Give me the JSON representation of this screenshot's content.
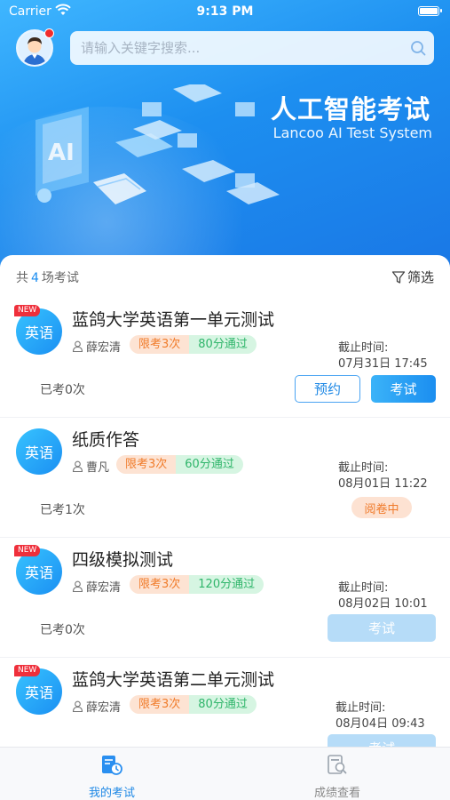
{
  "status_bar": {
    "carrier": "Carrier",
    "time": "9:13 PM"
  },
  "search": {
    "placeholder": "请输入关键字搜索..."
  },
  "hero": {
    "title": "人工智能考试",
    "subtitle": "Lancoo AI Test System"
  },
  "summary": {
    "prefix": "共",
    "count": "4",
    "suffix": "场考试",
    "filter_label": "筛选"
  },
  "exams": [
    {
      "new": "NEW",
      "subject": "英语",
      "title": "蓝鸽大学英语第一单元测试",
      "teacher": "薛宏清",
      "limit": "限考3次",
      "pass": "80分通过",
      "deadline_label": "截止时间:",
      "deadline": "07月31日 17:45",
      "taken": "已考0次",
      "btn_reserve": "预约",
      "btn_exam": "考试"
    },
    {
      "subject": "英语",
      "title": "纸质作答",
      "teacher": "曹凡",
      "limit": "限考3次",
      "pass": "60分通过",
      "deadline_label": "截止时间:",
      "deadline": "08月01日 11:22",
      "taken": "已考1次",
      "status": "阅卷中"
    },
    {
      "new": "NEW",
      "subject": "英语",
      "title": "四级模拟测试",
      "teacher": "薛宏清",
      "limit": "限考3次",
      "pass": "120分通过",
      "deadline_label": "截止时间:",
      "deadline": "08月02日 10:01",
      "taken": "已考0次",
      "btn_exam": "考试"
    },
    {
      "new": "NEW",
      "subject": "英语",
      "title": "蓝鸽大学英语第二单元测试",
      "teacher": "薛宏清",
      "limit": "限考3次",
      "pass": "80分通过",
      "deadline_label": "截止时间:",
      "deadline": "08月04日 09:43",
      "btn_exam": "考试"
    }
  ],
  "tabbar": {
    "mine": "我的考试",
    "scores": "成绩查看"
  },
  "colors": {
    "accent": "#1e88e5",
    "limit": "#f07c2b",
    "pass": "#2fb56a",
    "new": "#ef2f3b"
  }
}
